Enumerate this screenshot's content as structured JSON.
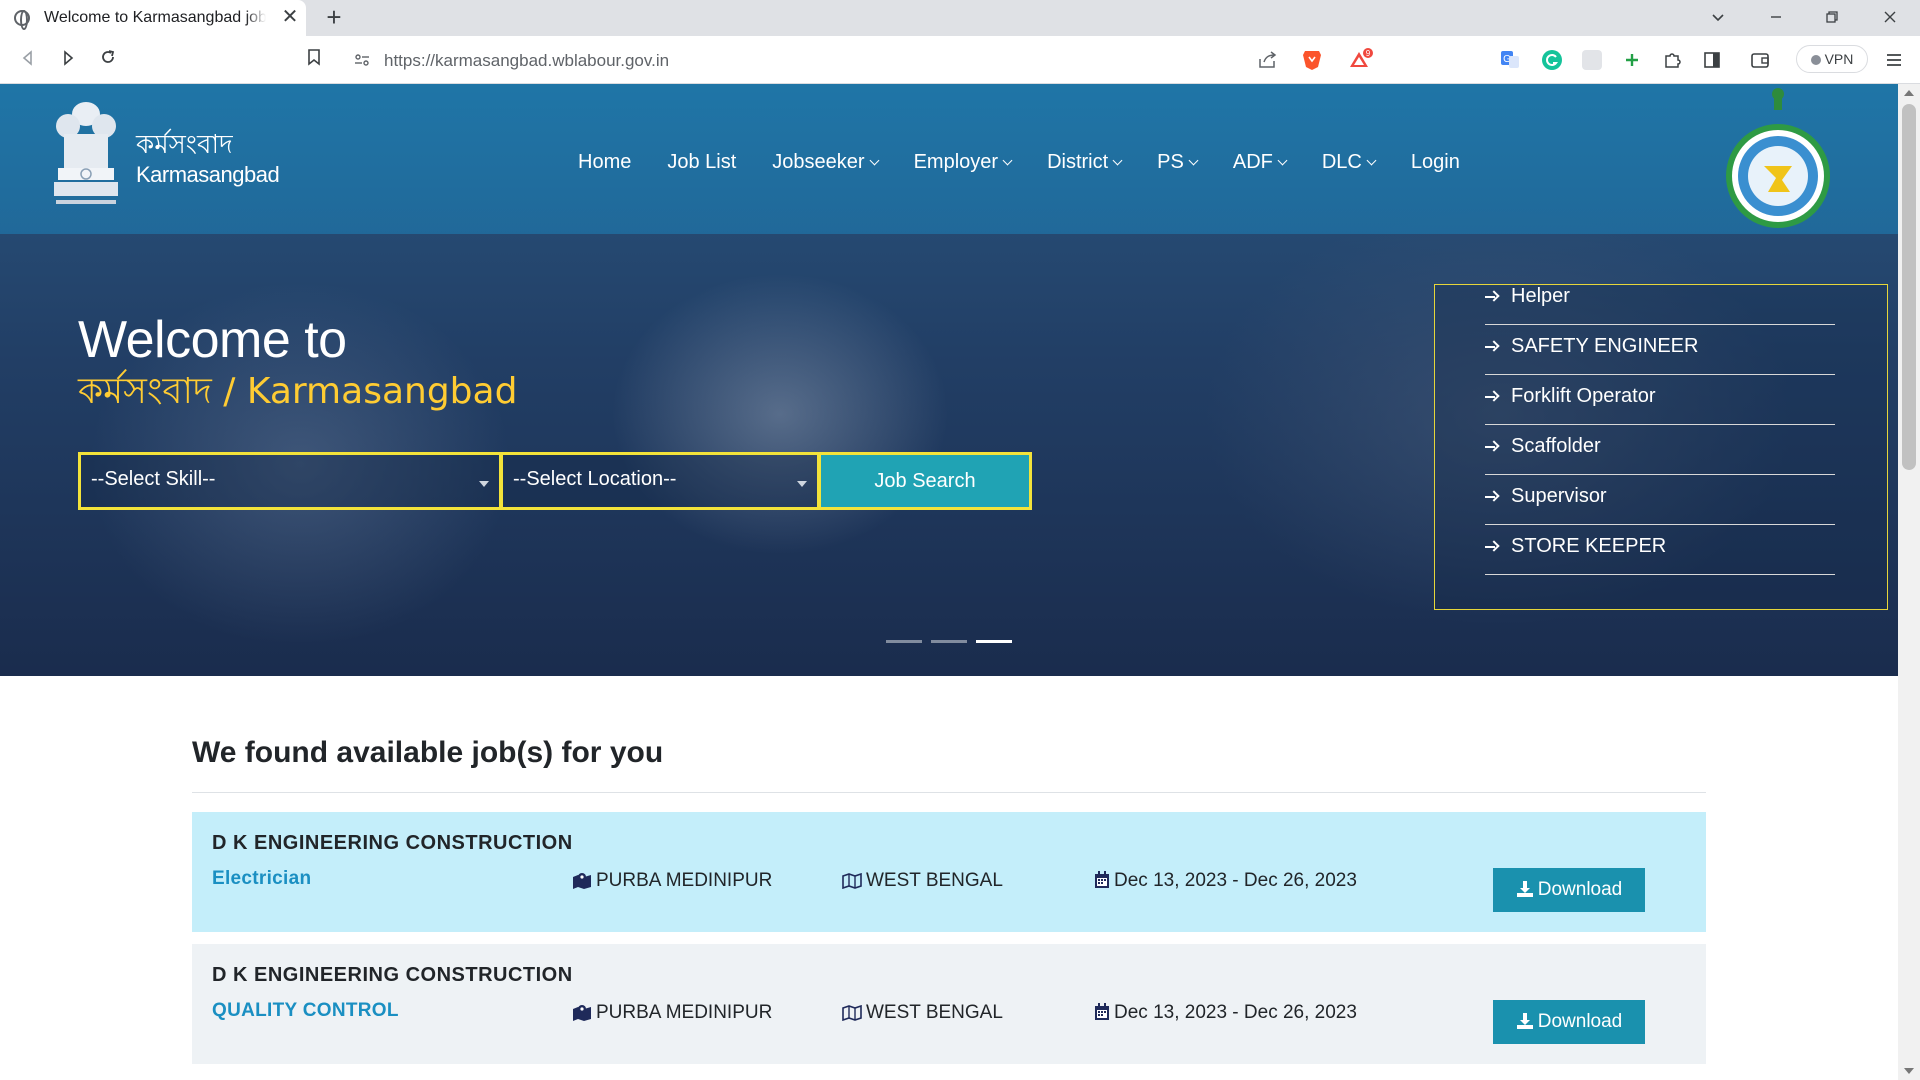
{
  "browser": {
    "tab_title": "Welcome to Karmasangbad job portal",
    "tab_close": "✕",
    "new_tab": "+",
    "url": "https://karmasangbad.wblabour.gov.in",
    "vpn_label": "VPN",
    "icons": [
      "back-icon",
      "forward-icon",
      "reload-icon",
      "bookmark-icon",
      "site-info-icon",
      "share-icon",
      "brave-shield-icon",
      "brave-rewards-icon",
      "translate-icon",
      "grammarly-icon",
      "extension-icon",
      "add-icon",
      "puzzle-icon",
      "sidebar-icon",
      "wallet-icon",
      "menu-icon"
    ],
    "brand_color": "#fb542b"
  },
  "header": {
    "brand_bn": "কর্মসংবাদ",
    "brand_en": "Karmasangbad",
    "menu": [
      {
        "label": "Home",
        "dropdown": false
      },
      {
        "label": "Job List",
        "dropdown": false
      },
      {
        "label": "Jobseeker",
        "dropdown": true
      },
      {
        "label": "Employer",
        "dropdown": true
      },
      {
        "label": "District",
        "dropdown": true
      },
      {
        "label": "PS",
        "dropdown": true
      },
      {
        "label": "ADF",
        "dropdown": true
      },
      {
        "label": "DLC",
        "dropdown": true
      },
      {
        "label": "Login",
        "dropdown": false
      }
    ]
  },
  "hero": {
    "welcome": "Welcome to",
    "subtitle": "কর্মসংবাদ / Karmasangbad",
    "skill_select": "--Select Skill--",
    "location_select": "--Select Location--",
    "search_button": "Job Search",
    "skills": [
      "Helper",
      "SAFETY ENGINEER",
      "Forklift Operator",
      "Scaffolder",
      "Supervisor",
      "STORE KEEPER"
    ],
    "active_slide": 3,
    "slide_count": 3,
    "accent_yellow": "#f3e33a",
    "accent_teal": "#20a3b4"
  },
  "results": {
    "title": "We found available job(s) for you",
    "jobs": [
      {
        "company": "D K ENGINEERING CONSTRUCTION",
        "role": "Electrician",
        "district": "PURBA MEDINIPUR",
        "state": "WEST BENGAL",
        "dates": "Dec 13, 2023 - Dec 26, 2023",
        "download": "Download",
        "bg": "#c4eefa"
      },
      {
        "company": "D K ENGINEERING CONSTRUCTION",
        "role": "QUALITY CONTROL",
        "district": "PURBA MEDINIPUR",
        "state": "WEST BENGAL",
        "dates": "Dec 13, 2023 - Dec 26, 2023",
        "download": "Download",
        "bg": "#eef2f5"
      }
    ]
  }
}
